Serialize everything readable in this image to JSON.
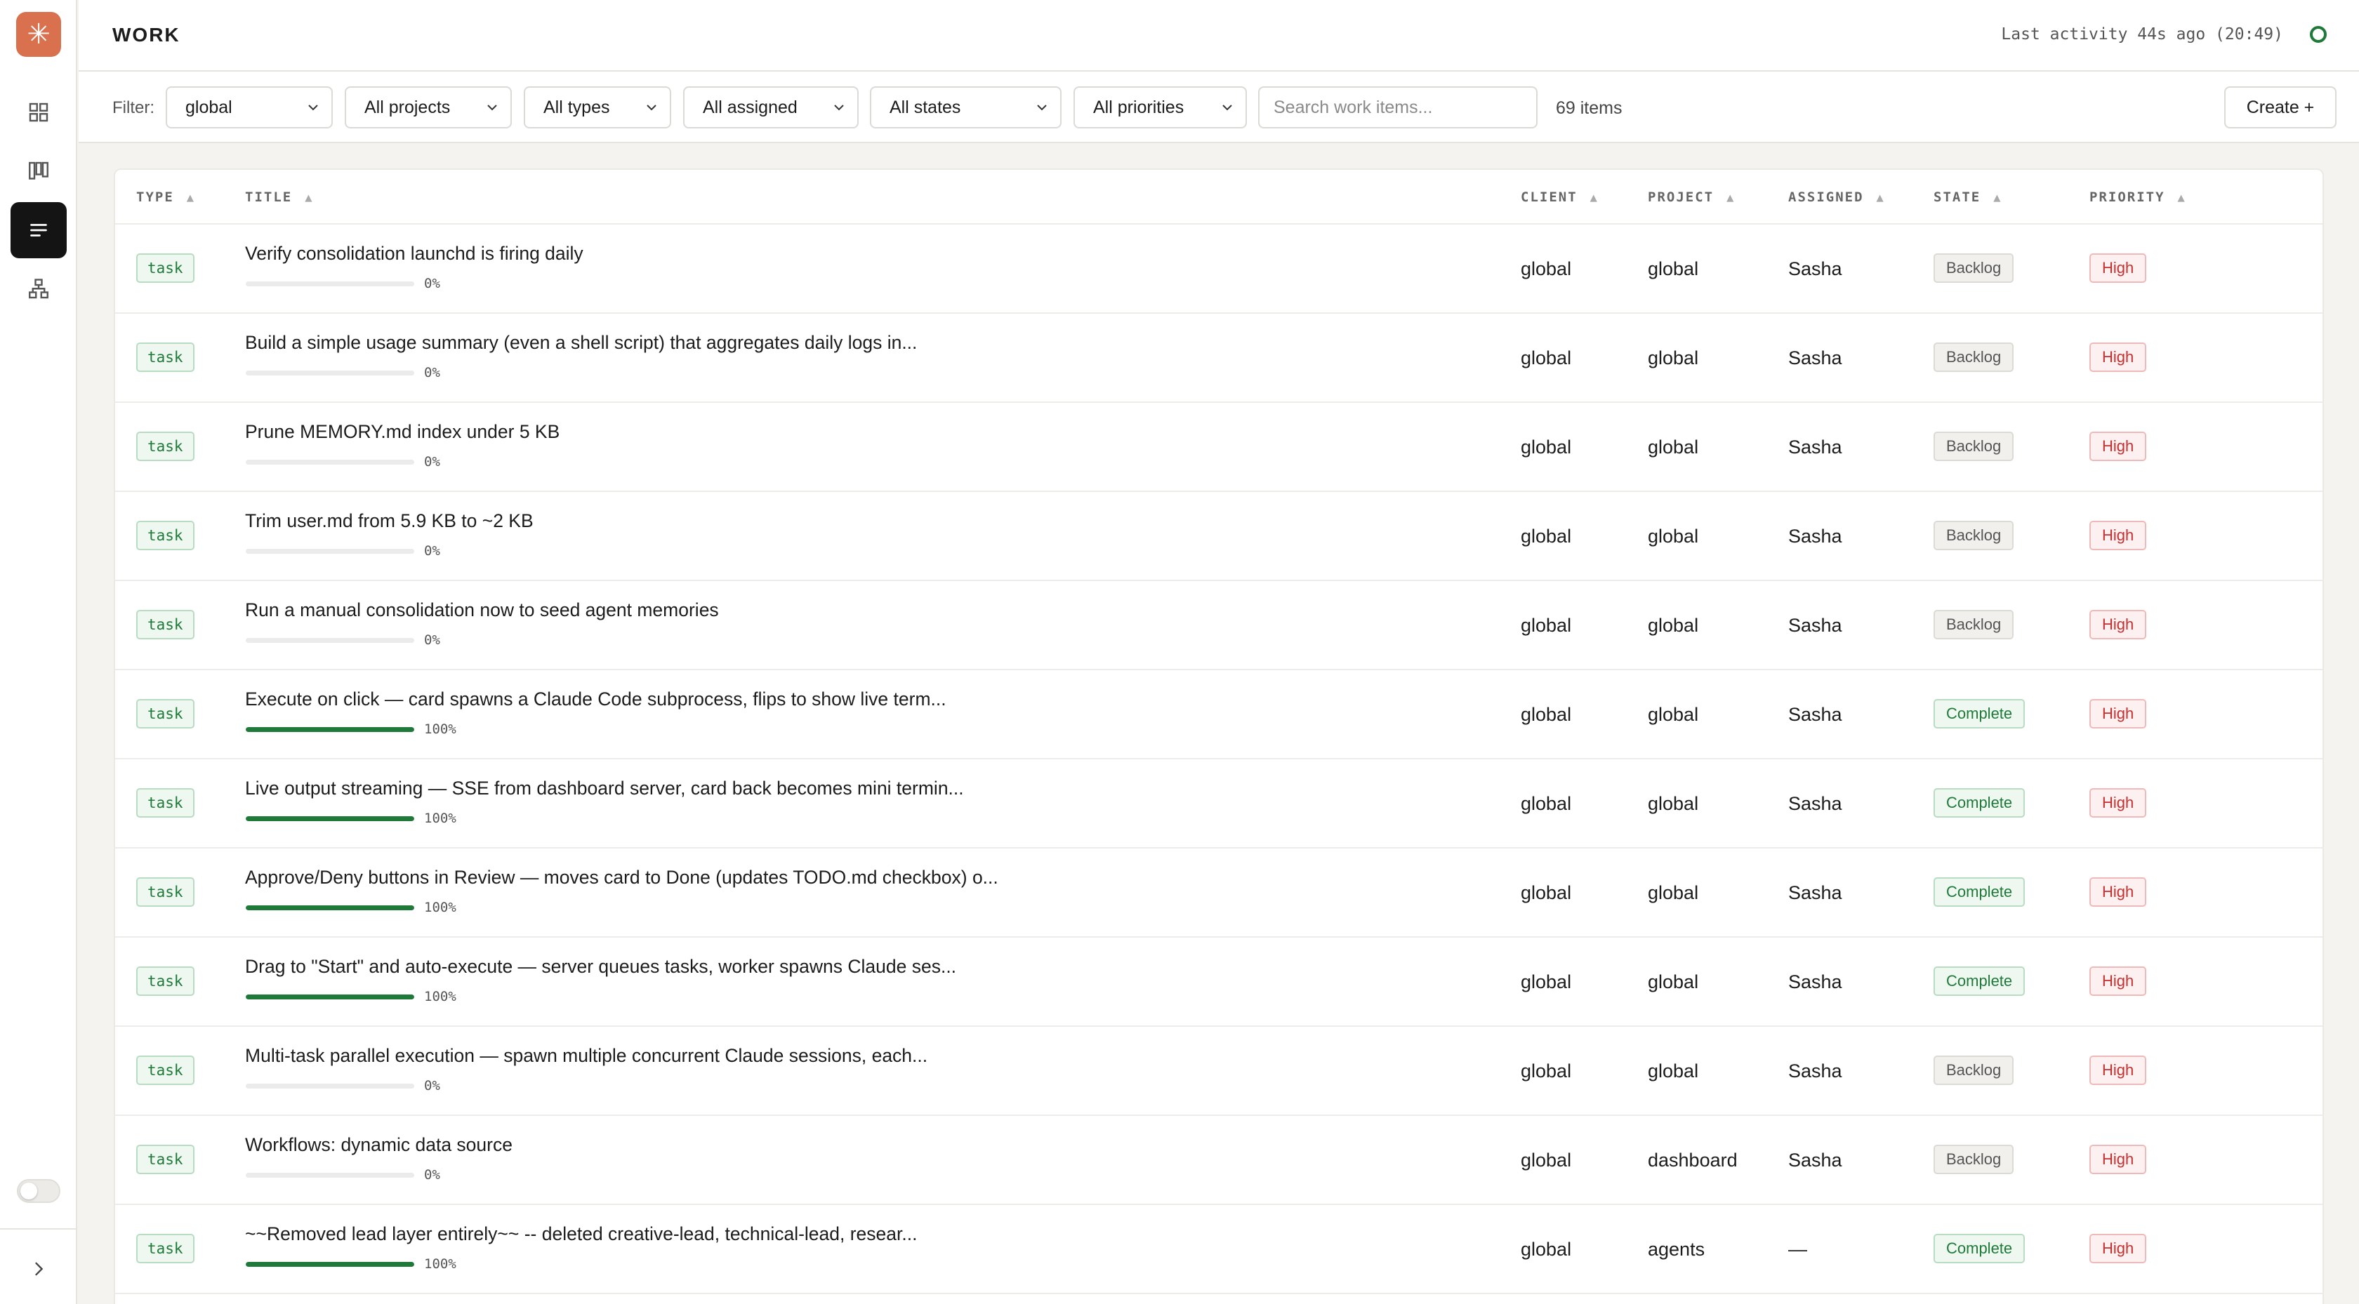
{
  "app": {
    "logo_glyph": "✳",
    "accent_color": "#d9714f"
  },
  "sidebar": {
    "items": [
      {
        "icon": "dashboard-grid-icon",
        "active": false
      },
      {
        "icon": "kanban-board-icon",
        "active": false
      },
      {
        "icon": "list-icon",
        "active": true
      },
      {
        "icon": "hierarchy-icon",
        "active": false
      }
    ],
    "expand_icon": "chevron-right-icon"
  },
  "header": {
    "title": "WORK",
    "activity": "Last activity 44s ago (20:49)",
    "status_color": "#1f7a3a"
  },
  "filters": {
    "label": "Filter:",
    "scope": "global",
    "projects": "All projects",
    "types": "All types",
    "assigned": "All assigned",
    "states": "All states",
    "priorities": "All priorities",
    "search_placeholder": "Search work items...",
    "count": "69 items",
    "create_label": "Create +"
  },
  "table": {
    "columns": {
      "type": "TYPE",
      "title": "TITLE",
      "client": "CLIENT",
      "project": "PROJECT",
      "assigned": "ASSIGNED",
      "state": "STATE",
      "priority": "PRIORITY"
    },
    "sort_arrow": "▲",
    "rows": [
      {
        "type": "task",
        "title": "Verify consolidation launchd is firing daily",
        "progress": 0,
        "progress_label": "0%",
        "client": "global",
        "project": "global",
        "assigned": "Sasha",
        "state": "Backlog",
        "priority": "High"
      },
      {
        "type": "task",
        "title": "Build a simple usage summary (even a shell script) that aggregates daily logs in...",
        "progress": 0,
        "progress_label": "0%",
        "client": "global",
        "project": "global",
        "assigned": "Sasha",
        "state": "Backlog",
        "priority": "High"
      },
      {
        "type": "task",
        "title": "Prune MEMORY.md index under 5 KB",
        "progress": 0,
        "progress_label": "0%",
        "client": "global",
        "project": "global",
        "assigned": "Sasha",
        "state": "Backlog",
        "priority": "High"
      },
      {
        "type": "task",
        "title": "Trim user.md from 5.9 KB to ~2 KB",
        "progress": 0,
        "progress_label": "0%",
        "client": "global",
        "project": "global",
        "assigned": "Sasha",
        "state": "Backlog",
        "priority": "High"
      },
      {
        "type": "task",
        "title": "Run a manual consolidation now to seed agent memories",
        "progress": 0,
        "progress_label": "0%",
        "client": "global",
        "project": "global",
        "assigned": "Sasha",
        "state": "Backlog",
        "priority": "High"
      },
      {
        "type": "task",
        "title": "Execute on click — card spawns a Claude Code subprocess, flips to show live term...",
        "progress": 100,
        "progress_label": "100%",
        "client": "global",
        "project": "global",
        "assigned": "Sasha",
        "state": "Complete",
        "priority": "High"
      },
      {
        "type": "task",
        "title": "Live output streaming — SSE from dashboard server, card back becomes mini termin...",
        "progress": 100,
        "progress_label": "100%",
        "client": "global",
        "project": "global",
        "assigned": "Sasha",
        "state": "Complete",
        "priority": "High"
      },
      {
        "type": "task",
        "title": "Approve/Deny buttons in Review — moves card to Done (updates TODO.md checkbox) o...",
        "progress": 100,
        "progress_label": "100%",
        "client": "global",
        "project": "global",
        "assigned": "Sasha",
        "state": "Complete",
        "priority": "High"
      },
      {
        "type": "task",
        "title": "Drag to \"Start\" and auto-execute — server queues tasks, worker spawns Claude ses...",
        "progress": 100,
        "progress_label": "100%",
        "client": "global",
        "project": "global",
        "assigned": "Sasha",
        "state": "Complete",
        "priority": "High"
      },
      {
        "type": "task",
        "title": "Multi-task parallel execution — spawn multiple concurrent Claude sessions, each...",
        "progress": 0,
        "progress_label": "0%",
        "client": "global",
        "project": "global",
        "assigned": "Sasha",
        "state": "Backlog",
        "priority": "High"
      },
      {
        "type": "task",
        "title": "Workflows: dynamic data source",
        "progress": 0,
        "progress_label": "0%",
        "client": "global",
        "project": "dashboard",
        "assigned": "Sasha",
        "state": "Backlog",
        "priority": "High"
      },
      {
        "type": "task",
        "title": "~~Removed lead layer entirely~~ -- deleted creative-lead, technical-lead, resear...",
        "progress": 100,
        "progress_label": "100%",
        "client": "global",
        "project": "agents",
        "assigned": "—",
        "state": "Complete",
        "priority": "High"
      }
    ]
  }
}
